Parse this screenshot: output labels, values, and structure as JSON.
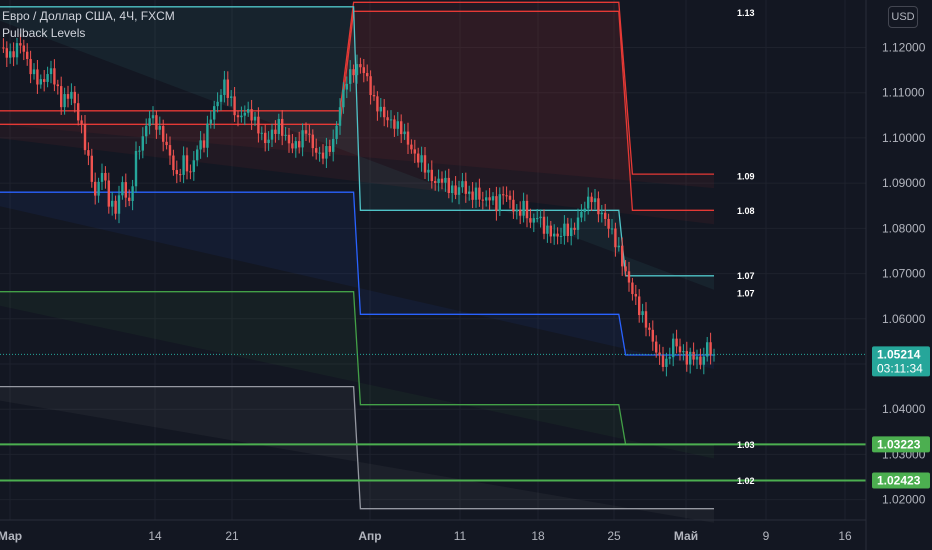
{
  "header": {
    "symbol_title": "Евро / Доллар США, 4Ч, FXCM",
    "indicator_name": "Pullback Levels",
    "currency_button": "USD"
  },
  "price_axis": {
    "min": 1.0155,
    "max": 1.1305,
    "ticks": [
      "1.12000",
      "1.11000",
      "1.10000",
      "1.09000",
      "1.08000",
      "1.07000",
      "1.06000",
      "1.05000",
      "1.04000",
      "1.03000",
      "1.02000"
    ],
    "tick_values": [
      1.12,
      1.11,
      1.1,
      1.09,
      1.08,
      1.07,
      1.06,
      1.05,
      1.04,
      1.03,
      1.02
    ]
  },
  "time_axis": {
    "labels": [
      {
        "text": "Мар",
        "bold": true
      },
      {
        "text": "14",
        "bold": false
      },
      {
        "text": "21",
        "bold": false
      },
      {
        "text": "Апр",
        "bold": true
      },
      {
        "text": "11",
        "bold": false
      },
      {
        "text": "18",
        "bold": false
      },
      {
        "text": "25",
        "bold": false
      },
      {
        "text": "Май",
        "bold": true
      },
      {
        "text": "9",
        "bold": false
      },
      {
        "text": "16",
        "bold": false
      }
    ]
  },
  "price_badges": [
    {
      "value": "1.05214",
      "sub": "03:11:34",
      "price": 1.05214,
      "color": "#26a69a"
    },
    {
      "value": "1.03223",
      "price": 1.03223,
      "color": "#4caf50"
    },
    {
      "value": "1.02423",
      "price": 1.02423,
      "color": "#4caf50"
    }
  ],
  "level_labels": [
    {
      "text": "1.13",
      "price": 1.1276
    },
    {
      "text": "1.09",
      "price": 1.0915
    },
    {
      "text": "1.08",
      "price": 1.0838
    },
    {
      "text": "1.07",
      "price": 1.0695
    },
    {
      "text": "1.07",
      "price": 1.0656
    },
    {
      "text": "1.03",
      "price": 1.0321
    },
    {
      "text": "1.02",
      "price": 1.0241
    }
  ],
  "colors": {
    "background": "#131722",
    "grid": "#1e222d",
    "up": "#26a69a",
    "down": "#ef5350",
    "red_level": "#e53935",
    "cyan_level": "#4fc3c7",
    "blue_level": "#2962ff",
    "green_level": "#43a047",
    "gray_level": "#9598a1",
    "bright_green": "#4caf50",
    "text": "#d1d4dc"
  },
  "chart_data": {
    "type": "candlestick",
    "title": "Евро / Доллар США, 4Ч, FXCM",
    "indicator": "Pullback Levels",
    "last_price": 1.05214,
    "ylim": [
      1.0155,
      1.1305
    ],
    "close_path": [
      [
        0,
        1.12
      ],
      [
        3,
        1.118
      ],
      [
        6,
        1.121
      ],
      [
        9,
        1.115
      ],
      [
        12,
        1.112
      ],
      [
        15,
        1.115
      ],
      [
        18,
        1.108
      ],
      [
        21,
        1.11
      ],
      [
        24,
        1.102
      ],
      [
        26,
        1.095
      ],
      [
        28,
        1.087
      ],
      [
        30,
        1.093
      ],
      [
        32,
        1.086
      ],
      [
        34,
        1.084
      ],
      [
        36,
        1.09
      ],
      [
        38,
        1.085
      ],
      [
        40,
        1.096
      ],
      [
        42,
        1.1
      ],
      [
        44,
        1.105
      ],
      [
        46,
        1.103
      ],
      [
        48,
        1.1
      ],
      [
        50,
        1.096
      ],
      [
        52,
        1.091
      ],
      [
        54,
        1.095
      ],
      [
        56,
        1.092
      ],
      [
        58,
        1.098
      ],
      [
        60,
        1.099
      ],
      [
        62,
        1.105
      ],
      [
        64,
        1.108
      ],
      [
        66,
        1.112
      ],
      [
        68,
        1.108
      ],
      [
        70,
        1.104
      ],
      [
        72,
        1.106
      ],
      [
        74,
        1.105
      ],
      [
        76,
        1.102
      ],
      [
        78,
        1.099
      ],
      [
        80,
        1.101
      ],
      [
        82,
        1.103
      ],
      [
        84,
        1.1
      ],
      [
        86,
        1.098
      ],
      [
        88,
        1.099
      ],
      [
        90,
        1.102
      ],
      [
        92,
        1.098
      ],
      [
        94,
        1.096
      ],
      [
        96,
        1.097
      ],
      [
        98,
        1.099
      ],
      [
        100,
        1.107
      ],
      [
        102,
        1.113
      ],
      [
        104,
        1.115
      ],
      [
        106,
        1.116
      ],
      [
        108,
        1.113
      ],
      [
        110,
        1.108
      ],
      [
        112,
        1.106
      ],
      [
        114,
        1.104
      ],
      [
        116,
        1.103
      ],
      [
        118,
        1.102
      ],
      [
        120,
        1.099
      ],
      [
        122,
        1.096
      ],
      [
        124,
        1.095
      ],
      [
        126,
        1.092
      ],
      [
        128,
        1.09
      ],
      [
        130,
        1.091
      ],
      [
        132,
        1.089
      ],
      [
        134,
        1.088
      ],
      [
        136,
        1.09
      ],
      [
        138,
        1.087
      ],
      [
        140,
        1.088
      ],
      [
        142,
        1.086
      ],
      [
        144,
        1.087
      ],
      [
        146,
        1.085
      ],
      [
        148,
        1.088
      ],
      [
        150,
        1.086
      ],
      [
        152,
        1.083
      ],
      [
        154,
        1.085
      ],
      [
        156,
        1.081
      ],
      [
        158,
        1.083
      ],
      [
        160,
        1.08
      ],
      [
        162,
        1.079
      ],
      [
        164,
        1.078
      ],
      [
        166,
        1.08
      ],
      [
        168,
        1.079
      ],
      [
        170,
        1.082
      ],
      [
        172,
        1.085
      ],
      [
        174,
        1.087
      ],
      [
        176,
        1.084
      ],
      [
        178,
        1.082
      ],
      [
        180,
        1.079
      ],
      [
        182,
        1.075
      ],
      [
        184,
        1.07
      ],
      [
        186,
        1.066
      ],
      [
        188,
        1.062
      ],
      [
        190,
        1.059
      ],
      [
        192,
        1.055
      ],
      [
        194,
        1.051
      ],
      [
        196,
        1.05
      ],
      [
        198,
        1.055
      ],
      [
        200,
        1.053
      ],
      [
        202,
        1.051
      ],
      [
        204,
        1.052
      ],
      [
        206,
        1.05
      ],
      [
        208,
        1.054
      ],
      [
        210,
        1.0521
      ]
    ],
    "levels": {
      "red_upper": [
        [
          0,
          1.106
        ],
        [
          100,
          1.106
        ],
        [
          104,
          1.13
        ],
        [
          182,
          1.13
        ],
        [
          186,
          1.092
        ],
        [
          210,
          1.092
        ]
      ],
      "red_lower": [
        [
          0,
          1.103
        ],
        [
          100,
          1.103
        ],
        [
          104,
          1.128
        ],
        [
          182,
          1.128
        ],
        [
          186,
          1.084
        ],
        [
          210,
          1.084
        ]
      ],
      "cyan": [
        [
          0,
          1.129
        ],
        [
          104,
          1.129
        ],
        [
          106,
          1.084
        ],
        [
          182,
          1.084
        ],
        [
          184,
          1.0695
        ],
        [
          210,
          1.0695
        ]
      ],
      "blue": [
        [
          0,
          1.088
        ],
        [
          104,
          1.088
        ],
        [
          106,
          1.061
        ],
        [
          182,
          1.061
        ],
        [
          184,
          1.052
        ],
        [
          210,
          1.052
        ]
      ],
      "green": [
        [
          0,
          1.066
        ],
        [
          104,
          1.066
        ],
        [
          106,
          1.041
        ],
        [
          182,
          1.041
        ],
        [
          184,
          1.0322
        ],
        [
          210,
          1.0322
        ]
      ],
      "gray": [
        [
          0,
          1.045
        ],
        [
          104,
          1.045
        ],
        [
          106,
          1.018
        ],
        [
          182,
          1.018
        ],
        [
          184,
          1.018
        ],
        [
          210,
          1.018
        ]
      ]
    }
  }
}
